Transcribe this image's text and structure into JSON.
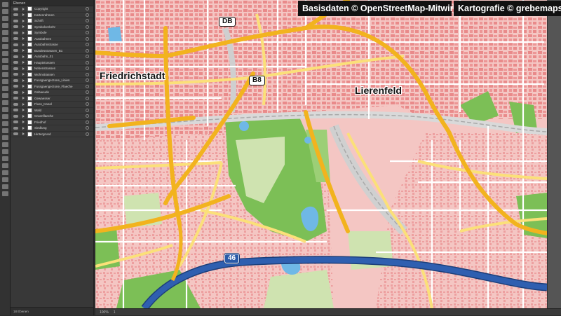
{
  "credits": {
    "data": "Basisdaten © OpenStreetMap-Mitwirkende",
    "cartography": "Kartografie © grebemaps.de"
  },
  "places": {
    "friedrichstadt": "Friedrichstadt",
    "lierenfeld": "Lierenfeld"
  },
  "road_labels": {
    "db": "DB",
    "b8": "B8",
    "a46": "46"
  },
  "layers_panel": {
    "title": "Ebenen",
    "footer": "18 Ebenen",
    "items": [
      "Copyright",
      "Kartenrahmen",
      "Schrift",
      "Symbolverkehr",
      "Symbole",
      "Autobahnen",
      "Autobahnstrasse",
      "Bundesstrassen_B1",
      "Autobahn_01",
      "Hauptstrassen",
      "Nebenstrassen",
      "Wohnstrassen",
      "Fussgaengerzone_Linien",
      "Fussgaengerzone_Flaeche",
      "Gebaeude",
      "Gewaesser",
      "Fluss_Kanal",
      "Wald",
      "Gruenflaeche",
      "Friedhof",
      "Siedlung",
      "Hintergrund"
    ]
  },
  "statusbar": {
    "zoom": "100%",
    "page": "1"
  },
  "colors": {
    "built_up": "#f4c6c3",
    "buildings": "#e98a8a",
    "forest": "#7cbf56",
    "meadow": "#cfe3b0",
    "water": "#6fb8e6",
    "main_road": "#f2b31e",
    "secondary_road": "#fbe079",
    "motorway": "#2f5fb0",
    "railway": "#bdbdbd"
  }
}
